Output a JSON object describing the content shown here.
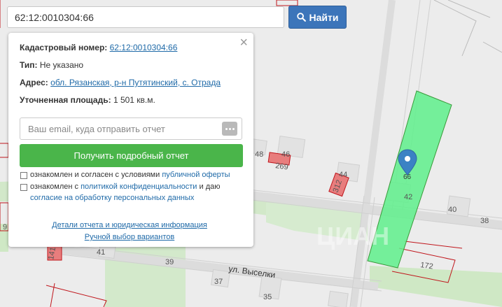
{
  "search": {
    "value": "62:12:0010304:66",
    "button_label": "Найти"
  },
  "popup": {
    "cadastral_label": "Кадастровый номер:",
    "cadastral_number": "62:12:0010304:66",
    "type_label": "Тип:",
    "type_value": "Не указано",
    "address_label": "Адрес:",
    "address_value": "обл. Рязанская, р-н Путятинский, с. Отрада",
    "area_label": "Уточненная площадь:",
    "area_value": "1 501 кв.м.",
    "email_placeholder": "Ваш email, куда отправить отчет",
    "report_button": "Получить подробный отчет",
    "consent1_text": "ознакомлен и согласен с условиями",
    "consent1_link": "публичной оферты",
    "consent2_text_a": "ознакомлен с",
    "consent2_link_a": "политикой конфиденциальности",
    "consent2_text_b": "и даю",
    "consent2_link_b": "согласие на обработку персональных данных",
    "details_link": "Детали отчета и юридическая информация",
    "manual_link": "Ручной выбор вариантов"
  },
  "map": {
    "street_name": "ул. Выселки",
    "house_numbers": [
      "48",
      "46",
      "44",
      "42",
      "40",
      "38",
      "41",
      "39",
      "37",
      "35",
      "9"
    ],
    "parcel_numbers": [
      "269",
      "312",
      "172"
    ],
    "marker_label": "66",
    "parcel_rotated_label": "141",
    "watermark": "ЦИАН"
  },
  "colors": {
    "highlight": "#5ff08c",
    "parcel_border": "#c0161c",
    "search_button": "#3c75ba",
    "report_button": "#4ab54a",
    "marker": "#3b82c4"
  }
}
